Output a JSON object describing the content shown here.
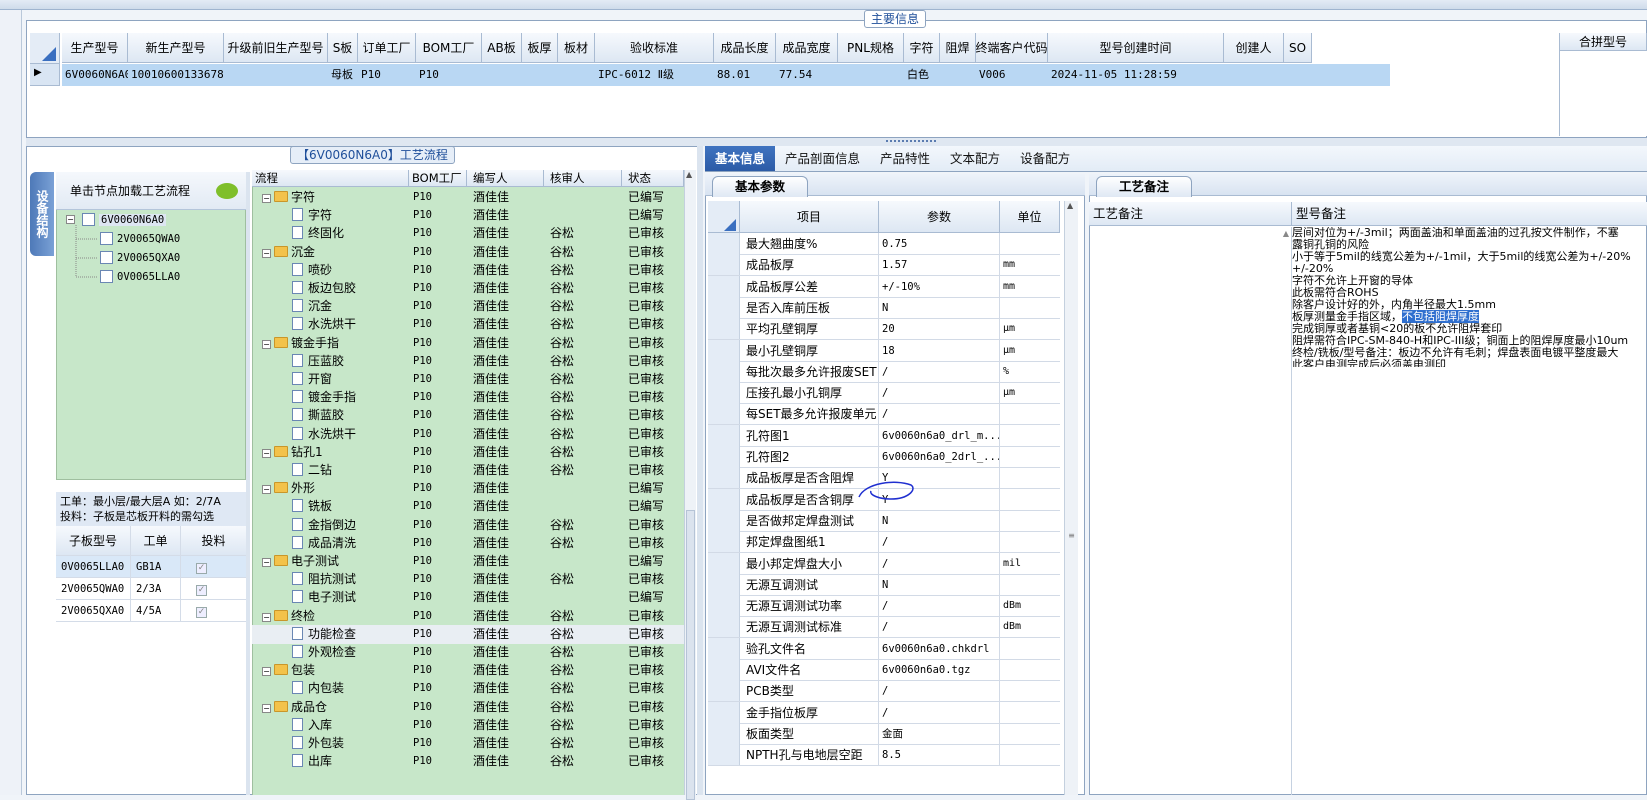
{
  "main_info": {
    "section_title": "主要信息",
    "columns": [
      "生产型号",
      "新生产型号",
      "升级前旧生产型号",
      "S板",
      "订单工厂",
      "BOM工厂",
      "AB板",
      "板厚",
      "板材",
      "验收标准",
      "成品长度",
      "成品宽度",
      "PNL规格",
      "字符",
      "阻焊",
      "终端客户代码",
      "型号创建时间",
      "创建人",
      "SO"
    ],
    "row": [
      "6V0060N6A0",
      "10010600133678",
      "",
      "母板",
      "P10",
      "P10",
      "",
      "",
      "",
      "IPC-6012 Ⅱ级",
      "88.01",
      "77.54",
      "",
      "白色",
      "",
      "V006",
      "2024-11-05 11:28:59",
      "",
      ""
    ],
    "merge_label": "合拼型号"
  },
  "process_panel": {
    "title": "【6V0060N6A0】工艺流程",
    "side_tab": "设备结构",
    "hint": "单击节点加载工艺流程",
    "tree": {
      "root": "6V0060N6A0",
      "children": [
        "2V0065QWA0",
        "2V0065QXA0",
        "0V0065LLA0"
      ]
    },
    "work_note_1": "工单：最小层/最大层A 如：2/7A",
    "work_note_2": "投料：子板是芯板开料的需勾选",
    "sub_grid": {
      "headers": [
        "子板型号",
        "工单",
        "投料"
      ],
      "rows": [
        [
          "0V0065LLA0",
          "GB1A",
          "✓"
        ],
        [
          "2V0065QWA0",
          "2/3A",
          "✓"
        ],
        [
          "2V0065QXA0",
          "4/5A",
          "✓"
        ]
      ]
    }
  },
  "flow": {
    "headers": [
      "流程",
      "BOM工厂",
      "编写人",
      "核审人",
      "状态"
    ],
    "rows": [
      {
        "name": "字符",
        "folder": true,
        "bom": "P10",
        "writer": "酒佳佳",
        "reviewer": "",
        "status": "已编写"
      },
      {
        "name": "字符",
        "folder": false,
        "bom": "P10",
        "writer": "酒佳佳",
        "reviewer": "",
        "status": "已编写"
      },
      {
        "name": "终固化",
        "folder": false,
        "bom": "P10",
        "writer": "酒佳佳",
        "reviewer": "谷松",
        "status": "已审核"
      },
      {
        "name": "沉金",
        "folder": true,
        "bom": "P10",
        "writer": "酒佳佳",
        "reviewer": "谷松",
        "status": "已审核"
      },
      {
        "name": "喷砂",
        "folder": false,
        "bom": "P10",
        "writer": "酒佳佳",
        "reviewer": "谷松",
        "status": "已审核"
      },
      {
        "name": "板边包胶",
        "folder": false,
        "bom": "P10",
        "writer": "酒佳佳",
        "reviewer": "谷松",
        "status": "已审核"
      },
      {
        "name": "沉金",
        "folder": false,
        "bom": "P10",
        "writer": "酒佳佳",
        "reviewer": "谷松",
        "status": "已审核"
      },
      {
        "name": "水洗烘干",
        "folder": false,
        "bom": "P10",
        "writer": "酒佳佳",
        "reviewer": "谷松",
        "status": "已审核"
      },
      {
        "name": "镀金手指",
        "folder": true,
        "bom": "P10",
        "writer": "酒佳佳",
        "reviewer": "谷松",
        "status": "已审核"
      },
      {
        "name": "压蓝胶",
        "folder": false,
        "bom": "P10",
        "writer": "酒佳佳",
        "reviewer": "谷松",
        "status": "已审核"
      },
      {
        "name": "开窗",
        "folder": false,
        "bom": "P10",
        "writer": "酒佳佳",
        "reviewer": "谷松",
        "status": "已审核"
      },
      {
        "name": "镀金手指",
        "folder": false,
        "bom": "P10",
        "writer": "酒佳佳",
        "reviewer": "谷松",
        "status": "已审核"
      },
      {
        "name": "撕蓝胶",
        "folder": false,
        "bom": "P10",
        "writer": "酒佳佳",
        "reviewer": "谷松",
        "status": "已审核"
      },
      {
        "name": "水洗烘干",
        "folder": false,
        "bom": "P10",
        "writer": "酒佳佳",
        "reviewer": "谷松",
        "status": "已审核"
      },
      {
        "name": "钻孔1",
        "folder": true,
        "bom": "P10",
        "writer": "酒佳佳",
        "reviewer": "谷松",
        "status": "已审核"
      },
      {
        "name": "二钻",
        "folder": false,
        "bom": "P10",
        "writer": "酒佳佳",
        "reviewer": "谷松",
        "status": "已审核"
      },
      {
        "name": "外形",
        "folder": true,
        "bom": "P10",
        "writer": "酒佳佳",
        "reviewer": "",
        "status": "已编写"
      },
      {
        "name": "铣板",
        "folder": false,
        "bom": "P10",
        "writer": "酒佳佳",
        "reviewer": "",
        "status": "已编写"
      },
      {
        "name": "金指倒边",
        "folder": false,
        "bom": "P10",
        "writer": "酒佳佳",
        "reviewer": "谷松",
        "status": "已审核"
      },
      {
        "name": "成品清洗",
        "folder": false,
        "bom": "P10",
        "writer": "酒佳佳",
        "reviewer": "谷松",
        "status": "已审核"
      },
      {
        "name": "电子测试",
        "folder": true,
        "bom": "P10",
        "writer": "酒佳佳",
        "reviewer": "",
        "status": "已编写"
      },
      {
        "name": "阻抗测试",
        "folder": false,
        "bom": "P10",
        "writer": "酒佳佳",
        "reviewer": "谷松",
        "status": "已审核"
      },
      {
        "name": "电子测试",
        "folder": false,
        "bom": "P10",
        "writer": "酒佳佳",
        "reviewer": "",
        "status": "已编写"
      },
      {
        "name": "终检",
        "folder": true,
        "bom": "P10",
        "writer": "酒佳佳",
        "reviewer": "谷松",
        "status": "已审核"
      },
      {
        "name": "功能检查",
        "folder": false,
        "bom": "P10",
        "writer": "酒佳佳",
        "reviewer": "谷松",
        "status": "已审核",
        "selected": true
      },
      {
        "name": "外观检查",
        "folder": false,
        "bom": "P10",
        "writer": "酒佳佳",
        "reviewer": "谷松",
        "status": "已审核"
      },
      {
        "name": "包装",
        "folder": true,
        "bom": "P10",
        "writer": "酒佳佳",
        "reviewer": "谷松",
        "status": "已审核"
      },
      {
        "name": "内包装",
        "folder": false,
        "bom": "P10",
        "writer": "酒佳佳",
        "reviewer": "谷松",
        "status": "已审核"
      },
      {
        "name": "成品仓",
        "folder": true,
        "bom": "P10",
        "writer": "酒佳佳",
        "reviewer": "谷松",
        "status": "已审核"
      },
      {
        "name": "入库",
        "folder": false,
        "bom": "P10",
        "writer": "酒佳佳",
        "reviewer": "谷松",
        "status": "已审核"
      },
      {
        "name": "外包装",
        "folder": false,
        "bom": "P10",
        "writer": "酒佳佳",
        "reviewer": "谷松",
        "status": "已审核"
      },
      {
        "name": "出库",
        "folder": false,
        "bom": "P10",
        "writer": "酒佳佳",
        "reviewer": "谷松",
        "status": "已审核"
      }
    ]
  },
  "tabs": [
    "基本信息",
    "产品剖面信息",
    "产品特性",
    "文本配方",
    "设备配方"
  ],
  "basic": {
    "panel_title": "基本参数",
    "headers": [
      "项目",
      "参数",
      "单位"
    ],
    "rows": [
      {
        "item": "最大翘曲度%",
        "value": "0.75",
        "unit": ""
      },
      {
        "item": "成品板厚",
        "value": "1.57",
        "unit": "mm"
      },
      {
        "item": "成品板厚公差",
        "value": "+/-10%",
        "unit": "mm"
      },
      {
        "item": "是否入库前压板",
        "value": "N",
        "unit": ""
      },
      {
        "item": "平均孔壁铜厚",
        "value": "20",
        "unit": "μm"
      },
      {
        "item": "最小孔壁铜厚",
        "value": "18",
        "unit": "μm"
      },
      {
        "item": "每批次最多允许报废SET",
        "value": "/",
        "unit": "%"
      },
      {
        "item": "压接孔最小孔铜厚",
        "value": "/",
        "unit": "μm"
      },
      {
        "item": "每SET最多允许报废单元",
        "value": "/",
        "unit": ""
      },
      {
        "item": "孔符图1",
        "value": "6v0060n6a0_drl_m...",
        "unit": ""
      },
      {
        "item": "孔符图2",
        "value": "6v0060n6a0_2drl_...",
        "unit": ""
      },
      {
        "item": "成品板厚是否含阻焊",
        "value": "Y",
        "unit": ""
      },
      {
        "item": "成品板厚是否含铜厚",
        "value": "Y",
        "unit": ""
      },
      {
        "item": "是否做邦定焊盘测试",
        "value": "N",
        "unit": ""
      },
      {
        "item": "邦定焊盘图纸1",
        "value": "/",
        "unit": ""
      },
      {
        "item": "最小邦定焊盘大小",
        "value": "/",
        "unit": "mil"
      },
      {
        "item": "无源互调测试",
        "value": "N",
        "unit": ""
      },
      {
        "item": "无源互调测试功率",
        "value": "/",
        "unit": "dBm"
      },
      {
        "item": "无源互调测试标准",
        "value": "/",
        "unit": "dBm"
      },
      {
        "item": "验孔文件名",
        "value": "6v0060n6a0.chkdrl",
        "unit": ""
      },
      {
        "item": "AVI文件名",
        "value": "6v0060n6a0.tgz",
        "unit": ""
      },
      {
        "item": "PCB类型",
        "value": "/",
        "unit": ""
      },
      {
        "item": "金手指位板厚",
        "value": "/",
        "unit": ""
      },
      {
        "item": "板面类型",
        "value": "金面",
        "unit": ""
      },
      {
        "item": "NPTH孔与电地层空距",
        "value": "8.5",
        "unit": ""
      }
    ]
  },
  "remarks": {
    "panel_title": "工艺备注",
    "col1": "工艺备注",
    "col2": "型号备注",
    "lines": [
      "层间对位为+/-3mil；两面盖油和单面盖油的过孔按文件制作，不塞",
      "露铜孔铜的风险",
      "小于等于5mil的线宽公差为+/-1mil，大于5mil的线宽公差为+/-20%",
      "+/-20%",
      "字符不允许上开窗的导体",
      "此板需符合ROHS",
      "除客户设计好的外，内角半径最大1.5mm",
      "板厚测量金手指区域，不包括阻焊厚度",
      "完成铜厚或者基铜<20的板不允许阻焊套印",
      "阻焊需符合IPC-SM-840-H和IPC-III级；铜面上的阻焊厚度最小10um",
      "终检/铣板/型号备注：板边不允许有毛刺；焊盘表面电镀平整度最大",
      "此客户电测完成后必须盖电测印"
    ]
  }
}
